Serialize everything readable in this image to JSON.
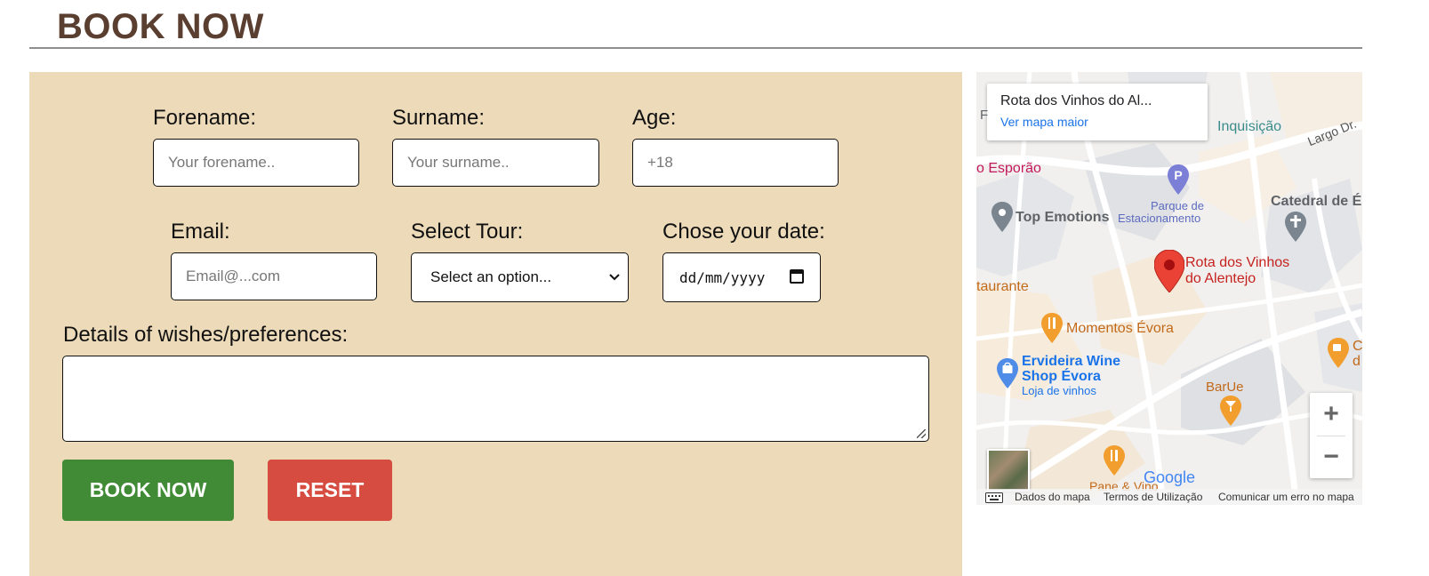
{
  "page": {
    "title": "BOOK NOW"
  },
  "form": {
    "forename": {
      "label": "Forename:",
      "placeholder": "Your forename.."
    },
    "surname": {
      "label": "Surname:",
      "placeholder": "Your surname.."
    },
    "age": {
      "label": "Age:",
      "placeholder": "+18"
    },
    "email": {
      "label": "Email:",
      "placeholder": "Email@...com"
    },
    "tour": {
      "label": "Select Tour:",
      "selected": "Select an option..."
    },
    "date": {
      "label": "Chose your date:",
      "value": "dd/mm/yyyy"
    },
    "details": {
      "label": "Details of wishes/preferences:",
      "value": ""
    },
    "book_button": "BOOK NOW",
    "reset_button": "RESET",
    "colors": {
      "panel": "#ecdab9",
      "book": "#418b37",
      "reset": "#d64c41"
    }
  },
  "map": {
    "card_title": "Rota dos Vinhos do Al...",
    "card_link": "Ver mapa maior",
    "labels": {
      "inquisicao": "Inquisição",
      "largo": "Largo Dr.",
      "esporao": "o Esporão",
      "parque": "Parque de",
      "estacionamento": "Estacionamento",
      "top_emotions": "Top Emotions",
      "catedral": "Catedral de É",
      "rota_1": "Rota dos Vinhos",
      "rota_2": "do Alentejo",
      "restaurante": "taurante",
      "momentos": "Momentos Évora",
      "ervideira_1": "Ervideira Wine",
      "ervideira_2": "Shop Évora",
      "loja": "Loja de vinhos",
      "barue": "BarUe",
      "pane": "Pane & Vino",
      "edge_c": "C",
      "edge_d": "d",
      "edge_f": "F"
    },
    "google": "Google",
    "zoom_in": "+",
    "zoom_out": "−",
    "footer": {
      "dados": "Dados do mapa",
      "termos": "Termos de Utilização",
      "erro": "Comunicar um erro no mapa"
    },
    "icons": [
      "map-pin-icon",
      "parking-icon",
      "cross-icon",
      "restaurant-icon",
      "shopping-bag-icon",
      "cocktail-icon",
      "cafe-icon",
      "keyboard-icon"
    ]
  }
}
